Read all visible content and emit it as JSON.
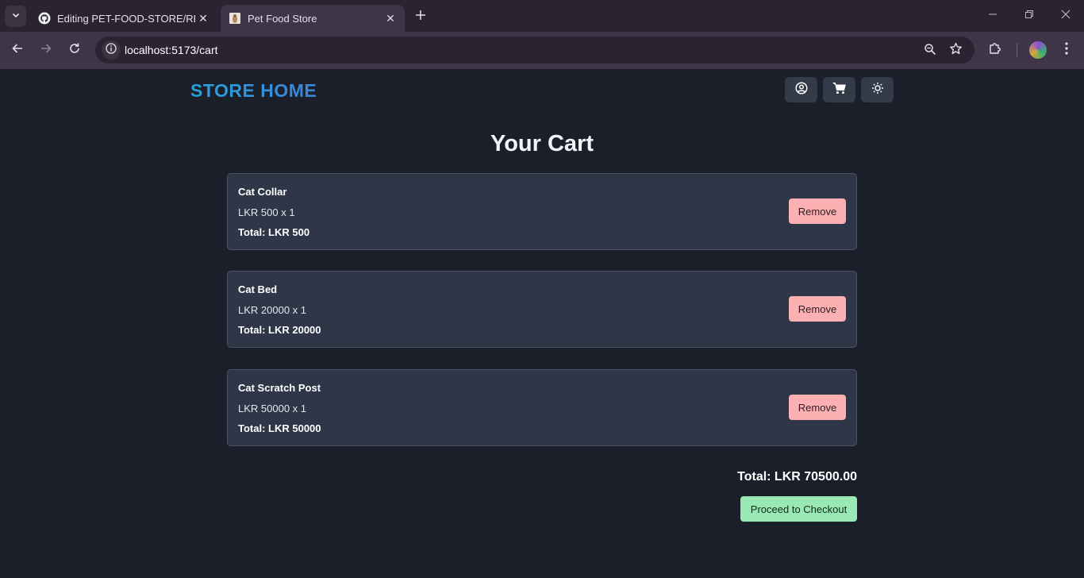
{
  "browser": {
    "tabs": [
      {
        "title": "Editing PET-FOOD-STORE/README",
        "active": false
      },
      {
        "title": "Pet Food Store",
        "active": true
      }
    ],
    "url": "localhost:5173/cart"
  },
  "header": {
    "brand": "STORE HOME",
    "icons": [
      "account-icon",
      "cart-icon",
      "theme-toggle-icon"
    ]
  },
  "cart": {
    "title": "Your Cart",
    "items": [
      {
        "name": "Cat Collar",
        "price_line": "LKR 500 x 1",
        "total_line": "Total: LKR 500",
        "remove_label": "Remove"
      },
      {
        "name": "Cat Bed",
        "price_line": "LKR 20000 x 1",
        "total_line": "Total: LKR 20000",
        "remove_label": "Remove"
      },
      {
        "name": "Cat Scratch Post",
        "price_line": "LKR 50000 x 1",
        "total_line": "Total: LKR 50000",
        "remove_label": "Remove"
      }
    ],
    "grand_total": "Total: LKR 70500.00",
    "checkout_label": "Proceed to Checkout"
  },
  "colors": {
    "page_bg": "#1b1f2a",
    "card_bg": "#2e3647",
    "remove_button": "#fcb0b2",
    "checkout_button": "#9ae8b4",
    "brand_accent": "#28a0dc"
  }
}
